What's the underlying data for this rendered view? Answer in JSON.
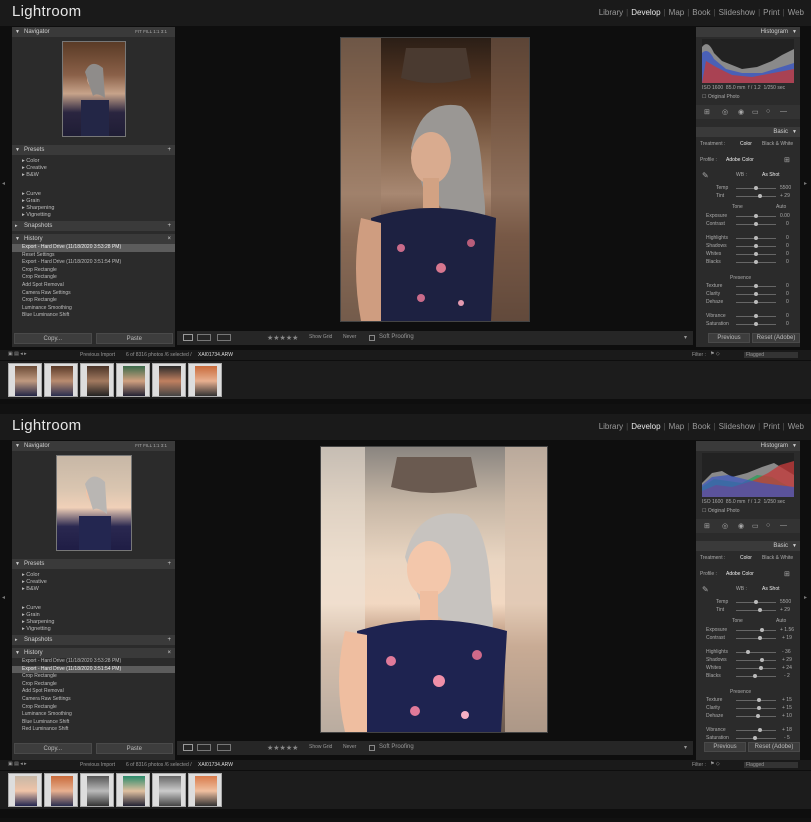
{
  "app": {
    "title": "Lightroom"
  },
  "modules": [
    "Library",
    "Develop",
    "Map",
    "Book",
    "Slideshow",
    "Print",
    "Web"
  ],
  "active_module": "Develop",
  "navigator": {
    "title": "Navigator",
    "zoom": [
      "FIT",
      "FILL",
      "1:1",
      "3:1"
    ]
  },
  "presets": {
    "title": "Presets",
    "groups_a": [
      "Color",
      "Creative",
      "B&W"
    ],
    "groups_b": [
      "Curve",
      "Grain",
      "Sharpening",
      "Vignetting"
    ]
  },
  "snapshots": {
    "title": "Snapshots"
  },
  "history": {
    "title": "History"
  },
  "history_top": [
    {
      "label": "Export - Hard Drive (11/18/2020 3:53:28 PM)",
      "value": ""
    },
    {
      "label": "Reset Settings",
      "value": ""
    },
    {
      "label": "Export - Hard Drive (11/18/2020 3:51:54 PM)",
      "value": ""
    },
    {
      "label": "Crop Rectangle",
      "value": ""
    },
    {
      "label": "Crop Rectangle",
      "value": ""
    },
    {
      "label": "Add Spot Removal",
      "value": ""
    },
    {
      "label": "Camera Raw Settings",
      "value": ""
    },
    {
      "label": "Crop Rectangle",
      "value": ""
    },
    {
      "label": "Luminance Smoothing",
      "value": ""
    },
    {
      "label": "Blue Luminance Shift",
      "value": ""
    }
  ],
  "history_bottom": [
    {
      "label": "Export - Hard Drive (11/18/2020 3:53:28 PM)",
      "value": ""
    },
    {
      "label": "Export - Hard Drive (11/18/2020 3:51:54 PM)",
      "value": ""
    },
    {
      "label": "Crop Rectangle",
      "value": ""
    },
    {
      "label": "Crop Rectangle",
      "value": ""
    },
    {
      "label": "Add Spot Removal",
      "value": ""
    },
    {
      "label": "Camera Raw Settings",
      "value": ""
    },
    {
      "label": "Crop Rectangle",
      "value": ""
    },
    {
      "label": "Luminance Smoothing",
      "value": ""
    },
    {
      "label": "Blue Luminance Shift",
      "value": ""
    },
    {
      "label": "Red Luminance Shift",
      "value": ""
    }
  ],
  "buttons": {
    "copy": "Copy...",
    "paste": "Paste",
    "previous": "Previous",
    "reset": "Reset (Adobe)"
  },
  "toolbar": {
    "soft_proofing": "Soft Proofing",
    "show_grid": "Show Grid",
    "never": "Never"
  },
  "histogram": {
    "title": "Histogram",
    "readout_top": [
      "ISO 1600",
      "85.0 mm",
      "f / 1.2",
      "1/250 sec"
    ],
    "original_photo": "Original Photo"
  },
  "basic": {
    "title": "Basic",
    "treatment_label": "Treatment :",
    "treatment": [
      "Color",
      "Black & White"
    ],
    "profile_label": "Profile :",
    "profile": "Adobe Color",
    "wb_label": "WB :",
    "wb": "As Shot",
    "tone_label": "Tone",
    "tone_auto": "Auto",
    "presence_label": "Presence"
  },
  "sliders_top": [
    {
      "label": "Temp",
      "value": "5500"
    },
    {
      "label": "Tint",
      "value": "+ 29"
    },
    {
      "label": "Exposure",
      "value": "0.00"
    },
    {
      "label": "Contrast",
      "value": "0"
    },
    {
      "label": "Highlights",
      "value": "0"
    },
    {
      "label": "Shadows",
      "value": "0"
    },
    {
      "label": "Whites",
      "value": "0"
    },
    {
      "label": "Blacks",
      "value": "0"
    },
    {
      "label": "Texture",
      "value": "0"
    },
    {
      "label": "Clarity",
      "value": "0"
    },
    {
      "label": "Dehaze",
      "value": "0"
    },
    {
      "label": "Vibrance",
      "value": "0"
    },
    {
      "label": "Saturation",
      "value": "0"
    }
  ],
  "sliders_bottom": [
    {
      "label": "Temp",
      "value": "5500"
    },
    {
      "label": "Tint",
      "value": "+ 29"
    },
    {
      "label": "Exposure",
      "value": "+ 1.56"
    },
    {
      "label": "Contrast",
      "value": "+ 19"
    },
    {
      "label": "Highlights",
      "value": "- 36"
    },
    {
      "label": "Shadows",
      "value": "+ 29"
    },
    {
      "label": "Whites",
      "value": "+ 24"
    },
    {
      "label": "Blacks",
      "value": "- 2"
    },
    {
      "label": "Texture",
      "value": "+ 15"
    },
    {
      "label": "Clarity",
      "value": "+ 15"
    },
    {
      "label": "Dehaze",
      "value": "+ 10"
    },
    {
      "label": "Vibrance",
      "value": "+ 18"
    },
    {
      "label": "Saturation",
      "value": "- 5"
    }
  ],
  "filmstrip": {
    "source": "Previous Import",
    "count": "6 of 8316 photos /6 selected /",
    "filename": "XAI01734.ARW",
    "filter_label": "Filter :",
    "filter_value": "Flagged"
  },
  "colors": {
    "accent": "#e0e0e0",
    "panel": "#2b2b2b",
    "selected": "#5c5c5c"
  }
}
